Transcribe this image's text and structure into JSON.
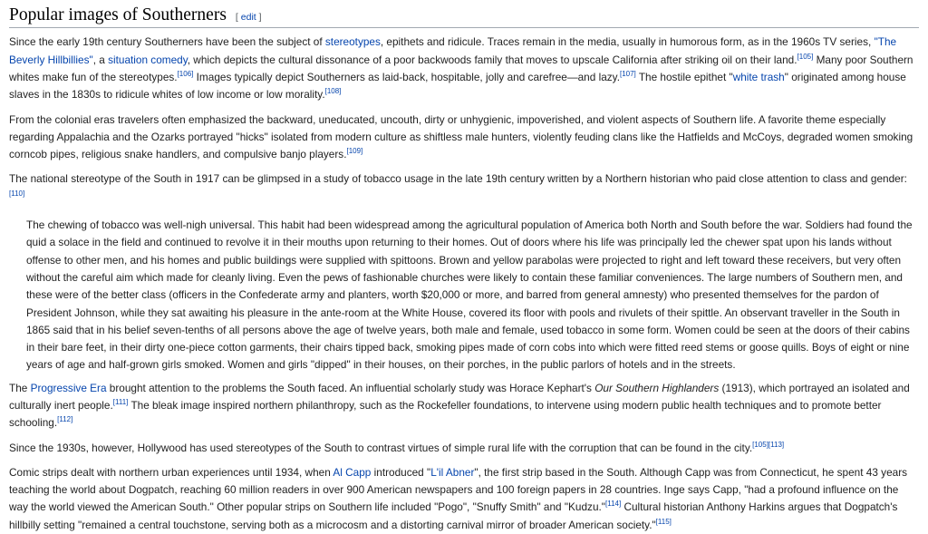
{
  "section": {
    "title": "Popular images of Southerners",
    "edit_open": "[",
    "edit_label": "edit",
    "edit_close": "]"
  },
  "p1": {
    "t1": "Since the early 19th century Southerners have been the subject of ",
    "link_stereotypes": "stereotypes",
    "t2": ", epithets and ridicule. Traces remain in the media, usually in humorous form, as in the 1960s TV series, ",
    "link_beverly": "\"The Beverly Hillbillies\"",
    "t3": ", a ",
    "link_sitcom": "situation comedy",
    "t4": ", which depicts the cultural dissonance of a poor backwoods family that moves to upscale California after striking oil on their land.",
    "ref1": "[105]",
    "t5": " Many poor Southern whites make fun of the stereotypes.",
    "ref2": "[106]",
    "t6": " Images typically depict Southerners as laid-back, hospitable, jolly and carefree—and lazy.",
    "ref3": "[107]",
    "t7": " The hostile epithet \"",
    "link_whitetrash": "white trash",
    "t8": "\" originated among house slaves in the 1830s to ridicule whites of low income or low morality.",
    "ref4": "[108]"
  },
  "p2": {
    "t1": "From the colonial eras travelers often emphasized the backward, uneducated, uncouth, dirty or unhygienic, impoverished, and violent aspects of Southern life. A favorite theme especially regarding Appalachia and the Ozarks portrayed \"hicks\" isolated from modern culture as shiftless male hunters, violently feuding clans like the Hatfields and McCoys, degraded women smoking corncob pipes, religious snake handlers, and compulsive banjo players.",
    "ref1": "[109]"
  },
  "p3": {
    "t1": "The national stereotype of the South in 1917 can be glimpsed in a study of tobacco usage in the late 19th century written by a Northern historian who paid close attention to class and gender:",
    "ref1": "[110]"
  },
  "quote": {
    "text": "The chewing of tobacco was well-nigh universal. This habit had been widespread among the agricultural population of America both North and South before the war. Soldiers had found the quid a solace in the field and continued to revolve it in their mouths upon returning to their homes. Out of doors where his life was principally led the chewer spat upon his lands without offense to other men, and his homes and public buildings were supplied with spittoons. Brown and yellow parabolas were projected to right and left toward these receivers, but very often without the careful aim which made for cleanly living. Even the pews of fashionable churches were likely to contain these familiar conveniences. The large numbers of Southern men, and these were of the better class (officers in the Confederate army and planters, worth $20,000 or more, and barred from general amnesty) who presented themselves for the pardon of President Johnson, while they sat awaiting his pleasure in the ante-room at the White House, covered its floor with pools and rivulets of their spittle. An observant traveller in the South in 1865 said that in his belief seven-tenths of all persons above the age of twelve years, both male and female, used tobacco in some form. Women could be seen at the doors of their cabins in their bare feet, in their dirty one-piece cotton garments, their chairs tipped back, smoking pipes made of corn cobs into which were fitted reed stems or goose quills. Boys of eight or nine years of age and half-grown girls smoked. Women and girls \"dipped\" in their houses, on their porches, in the public parlors of hotels and in the streets."
  },
  "p4": {
    "t1": "The ",
    "link_progressive": "Progressive Era",
    "t2": " brought attention to the problems the South faced. An influential scholarly study was Horace Kephart's ",
    "italic": "Our Southern Highlanders",
    "t3": " (1913), which portrayed an isolated and culturally inert people.",
    "ref1": "[111]",
    "t4": " The bleak image inspired northern philanthropy, such as the Rockefeller foundations, to intervene using modern public health techniques and to promote better schooling.",
    "ref2": "[112]"
  },
  "p5": {
    "t1": "Since the 1930s, however, Hollywood has used stereotypes of the South to contrast virtues of simple rural life with the corruption that can be found in the city.",
    "ref1": "[105]",
    "ref2": "[113]"
  },
  "p6": {
    "t1": "Comic strips dealt with northern urban experiences until 1934, when ",
    "link_alcapp": "Al Capp",
    "t2": " introduced \"",
    "link_lilabner": "L'il Abner",
    "t3": "\", the first strip based in the South. Although Capp was from Connecticut, he spent 43 years teaching the world about Dogpatch, reaching 60 million readers in over 900 American newspapers and 100 foreign papers in 28 countries. Inge says Capp, \"had a profound influence on the way the world viewed the American South.\" Other popular strips on Southern life included \"Pogo\", \"Snuffy Smith\" and \"Kudzu.\"",
    "ref1": "[114]",
    "t4": " Cultural historian Anthony Harkins argues that Dogpatch's hillbilly setting \"remained a central touchstone, serving both as a microcosm and a distorting carnival mirror of broader American society.\"",
    "ref2": "[115]"
  }
}
